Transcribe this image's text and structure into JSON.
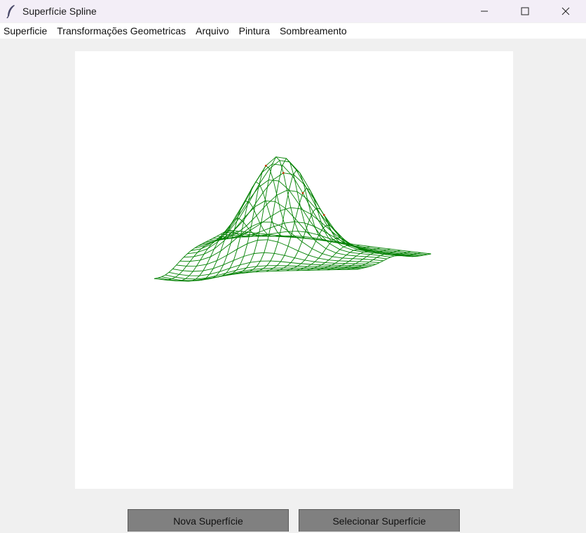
{
  "window": {
    "title": "Superfície Spline",
    "minimize_icon": "minimize-icon",
    "maximize_icon": "maximize-icon",
    "close_icon": "close-icon",
    "app_icon": "feather-icon"
  },
  "menu": [
    {
      "label": "Superficie"
    },
    {
      "label": "Transformações Geometricas"
    },
    {
      "label": "Arquivo"
    },
    {
      "label": "Pintura"
    },
    {
      "label": "Sombreamento"
    }
  ],
  "canvas": {
    "background": "#ffffff",
    "wire_color": "#008000",
    "control_color": "#cc3300",
    "content": "wireframe spline surface"
  },
  "buttons": {
    "new_surface": "Nova Superfície",
    "select_surface": "Selecionar Superfície"
  }
}
